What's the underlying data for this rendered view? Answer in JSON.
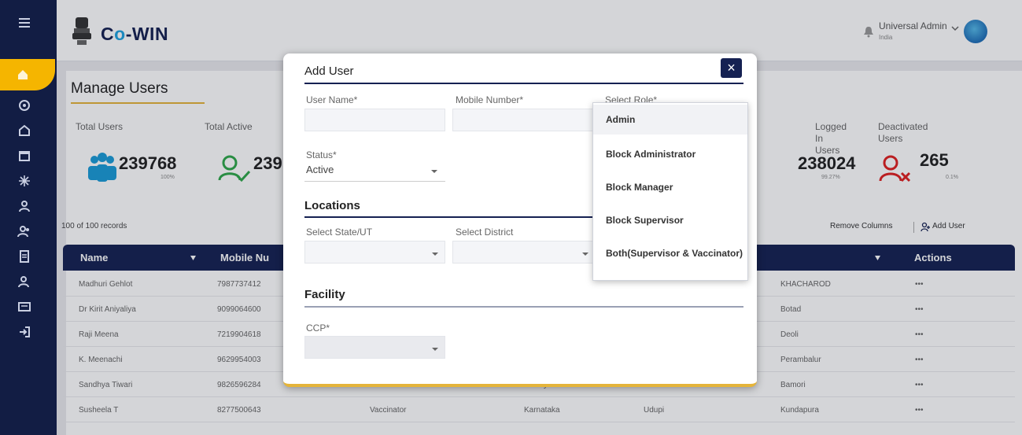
{
  "app": {
    "brand_prefix": "C",
    "brand_o": "o",
    "brand_suffix": "-WIN"
  },
  "header": {
    "user_name": "Universal Admin",
    "user_sub": "India"
  },
  "page": {
    "title": "Manage Users"
  },
  "stats": [
    {
      "label": "Total Users",
      "value": "239768",
      "pct": "100%"
    },
    {
      "label": "Total Active",
      "value": "239",
      "pct": ""
    },
    {
      "label": "Logged In Users",
      "value": "238024",
      "pct": "99.27%"
    },
    {
      "label": "Deactivated Users",
      "value": "265",
      "pct": "0.1%"
    }
  ],
  "table": {
    "records": "100 of 100 records",
    "remove_columns": "Remove Columns",
    "add_user": "Add User",
    "columns": [
      "Name",
      "Mobile Nu",
      "Actions"
    ],
    "rows": [
      {
        "name": "Madhuri Gehlot",
        "mobile": "7987737412",
        "role": "",
        "state": "",
        "district": "",
        "block": "KHACHAROD",
        "actions": "•••"
      },
      {
        "name": "Dr Kirit Aniyaliya",
        "mobile": "9099064600",
        "role": "",
        "state": "",
        "district": "",
        "block": "Botad",
        "actions": "•••"
      },
      {
        "name": "Raji Meena",
        "mobile": "7219904618",
        "role": "",
        "state": "",
        "district": "",
        "block": "Deoli",
        "actions": "•••"
      },
      {
        "name": "K. Meenachi",
        "mobile": "9629954003",
        "role": "",
        "state": "",
        "district": "",
        "block": "Perambalur",
        "actions": "•••"
      },
      {
        "name": "Sandhya Tiwari",
        "mobile": "9826596284",
        "role": "Vaccinator",
        "state": "Madhya Pradesh",
        "district": "Guna",
        "block": "Bamori",
        "actions": "•••"
      },
      {
        "name": "Susheela T",
        "mobile": "8277500643",
        "role": "Vaccinator",
        "state": "Karnataka",
        "district": "Udupi",
        "block": "Kundapura",
        "actions": "•••"
      }
    ]
  },
  "modal": {
    "title": "Add User",
    "close": "×",
    "user_name_label": "User Name*",
    "mobile_label": "Mobile Number*",
    "role_label": "Select Role*",
    "status_label": "Status*",
    "status_value": "Active",
    "locations_title": "Locations",
    "state_label": "Select State/UT",
    "district_label": "Select District",
    "facility_title": "Facility",
    "ccp_label": "CCP*"
  },
  "role_dropdown": {
    "options": [
      "Admin",
      "Block Administrator",
      "Block Manager",
      "Block Supervisor",
      "Both(Supervisor & Vaccinator)"
    ],
    "highlighted": "Admin"
  },
  "colors": {
    "navy": "#152152",
    "accent": "#e5b43a",
    "red": "#e02020",
    "green": "#2fa84a"
  }
}
